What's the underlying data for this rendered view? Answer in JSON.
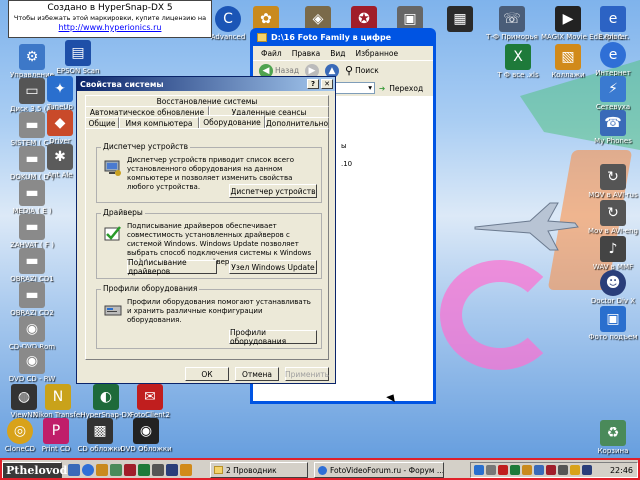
{
  "hypersnap": {
    "title": "Создано в HyperSnap-DX 5",
    "subtitle": "Чтобы избежать этой маркировки, купите лицензию на",
    "url": "http://www.hyperionics.ru"
  },
  "desktop_icons_left": [
    {
      "label": "Управление"
    },
    {
      "label": "Диск 3,5 (A)"
    },
    {
      "label": "SISTEM ( C )"
    },
    {
      "label": "DOKUM ( D )"
    },
    {
      "label": "MEDIA   ( E )"
    },
    {
      "label": "ZAHVAT ( F )"
    },
    {
      "label": "OBRAZI CD1"
    },
    {
      "label": "OBRAZI CD2"
    },
    {
      "label": "CD-DVD Rom"
    },
    {
      "label": "DVD CD - RW"
    }
  ],
  "desktop_icons_col2": [
    {
      "label": "EPSON Scan"
    },
    {
      "label": "TuneUp"
    },
    {
      "label": "Driver"
    },
    {
      "label": "Ant Ale"
    }
  ],
  "desktop_icons_top": [
    {
      "label": "Advanced"
    }
  ],
  "desktop_icons_bottom": [
    {
      "label": "ViewNX"
    },
    {
      "label": "Nikon Transfer"
    },
    {
      "label": "HyperSnap-DX"
    },
    {
      "label": "FotoClient2"
    },
    {
      "label": "CloneCD"
    },
    {
      "label": "Print CD"
    },
    {
      "label": "CD обложки"
    },
    {
      "label": "DVD Обложки"
    }
  ],
  "desktop_icons_right_inner": [
    {
      "label": "Т-Ф Приморья"
    },
    {
      "label": "MAGIX Movie Edit Pro 1..."
    },
    {
      "label": "Т Ф все .xls"
    },
    {
      "label": "Коллажи"
    }
  ],
  "desktop_icons_right": [
    {
      "label": "Explorer"
    },
    {
      "label": "Интернет"
    },
    {
      "label": "Сетевуха"
    },
    {
      "label": "My Phones"
    },
    {
      "label": "MOV в AVI-rus"
    },
    {
      "label": "Mov в AVI-eng"
    },
    {
      "label": "WAV в MMF"
    },
    {
      "label": "Doctor Div X"
    },
    {
      "label": "Фото подъем"
    },
    {
      "label": "Корзина"
    }
  ],
  "explorer": {
    "title": "D:\\16 Foto Family в цифре",
    "menu": [
      "Файл",
      "Правка",
      "Вид",
      "Избранное"
    ],
    "back_label": "Назад",
    "search_label": "Поиск",
    "go_label": "Переход",
    "frag1": "ы",
    "frag2": ".10"
  },
  "dialog": {
    "title": "Свойства системы",
    "help_btn": "?",
    "close_btn": "✕",
    "tabs_row1": [
      "Восстановление системы"
    ],
    "tabs_row2": [
      "Автоматическое обновление",
      "Удаленные сеансы"
    ],
    "tabs_row3": [
      "Общие",
      "Имя компьютера",
      "Оборудование",
      "Дополнительно"
    ],
    "device_manager": {
      "title": "Диспетчер устройств",
      "text": "Диспетчер устройств приводит список всего установленного оборудования на данном компьютере и позволяет изменить свойства любого устройства.",
      "button": "Диспетчер устройств"
    },
    "drivers": {
      "title": "Драйверы",
      "text": "Подписывание драйверов обеспечивает совместимость установленных драйверов с системой Windows.  Windows Update позволяет выбрать способ подключения системы к Windows Update для поиска драйверов.",
      "button1": "Подписывание драйверов",
      "button2": "Узел Windows Update"
    },
    "profiles": {
      "title": "Профили оборудования",
      "text": "Профили оборудования помогают устанавливать и хранить различные конфигурации оборудования.",
      "button": "Профили оборудования"
    },
    "ok": "ОК",
    "cancel": "Отмена",
    "apply": "Применить"
  },
  "taskbar": {
    "start_label": "Pthelovod",
    "task1": "2 Проводник",
    "task2": "FotoVideoForum.ru - Форум ...",
    "clock": "22:46"
  }
}
